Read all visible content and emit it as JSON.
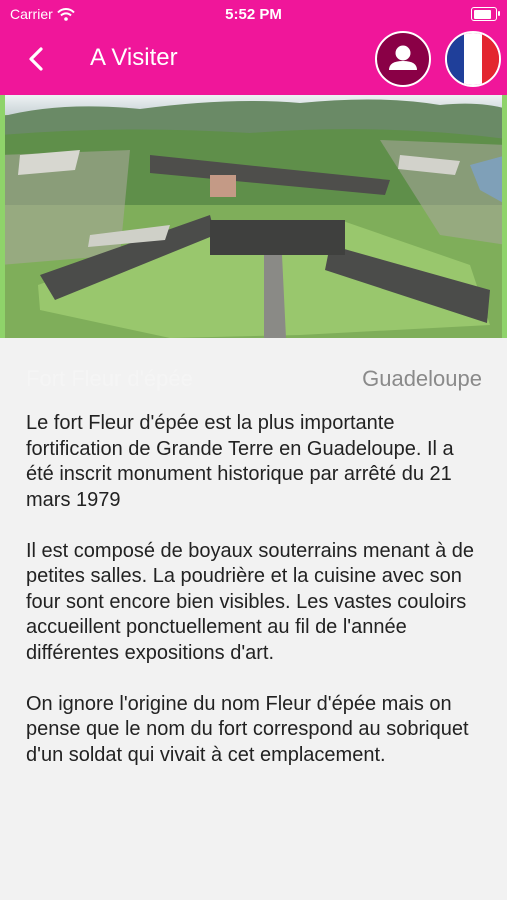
{
  "status_bar": {
    "carrier": "Carrier",
    "time": "5:52 PM",
    "battery_level": 0.85
  },
  "header": {
    "title": "A Visiter",
    "back_icon": "chevron-left-icon",
    "profile_icon": "user-icon",
    "language_flag": "france-flag-icon",
    "colors": {
      "background": "#f0169a",
      "profile_circle": "#8a0046"
    }
  },
  "place": {
    "name": "Fort Fleur d'épée",
    "region": "Guadeloupe",
    "paragraphs": [
      "Le fort Fleur d'épée est la plus importante fortification de Grande Terre en Guadeloupe. Il a été inscrit monument historique par arrêté du 21 mars 1979",
      "Il est composé de boyaux souterrains menant à de petites salles. La poudrière et la cuisine avec son four sont encore bien visibles. Les vastes couloirs accueillent ponctuellement au fil de l'année différentes expositions d'art.",
      "On ignore l'origine du nom Fleur d'épée mais on pense que le nom du fort correspond au sobriquet d'un soldat qui vivait à cet emplacement."
    ]
  }
}
